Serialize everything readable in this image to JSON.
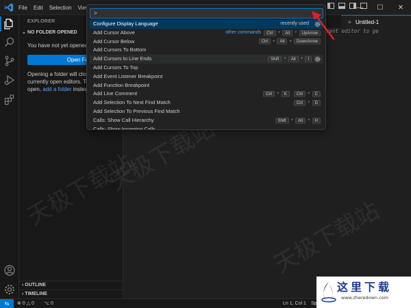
{
  "menubar": {
    "items": [
      "File",
      "Edit",
      "Selection",
      "View"
    ]
  },
  "window_controls": {
    "minimize": "—",
    "maximize": "☐",
    "close": "✕"
  },
  "sidebar": {
    "title": "EXPLORER",
    "section": "NO FOLDER OPENED",
    "line1": "You have not yet opened",
    "open_folder_label": "Open Folder",
    "line2": "Opening a folder will clos",
    "line3": "currently open editors. To",
    "line4_prefix": "open, ",
    "line4_link": "add a folder",
    "line4_suffix": " instea",
    "outline_label": "OUTLINE",
    "timeline_label": "TIMELINE"
  },
  "editor": {
    "tab_label": "Untitled-1",
    "hint_text": "rent editor to ge"
  },
  "palette": {
    "input_value": ">",
    "commands": [
      {
        "label": "Configure Display Language",
        "tag": "recently used",
        "tag_style": "normal",
        "keys": [],
        "gear": true,
        "state": "selected"
      },
      {
        "label": "Add Cursor Above",
        "tag": "other commands",
        "tag_style": "blue",
        "keys": [
          "Ctrl",
          "Alt",
          "UpArrow"
        ],
        "gear": false,
        "state": ""
      },
      {
        "label": "Add Cursor Below",
        "tag": "",
        "tag_style": "",
        "keys": [
          "Ctrl",
          "Alt",
          "DownArrow"
        ],
        "gear": false,
        "state": ""
      },
      {
        "label": "Add Cursors To Bottom",
        "tag": "",
        "tag_style": "",
        "keys": [],
        "gear": false,
        "state": ""
      },
      {
        "label": "Add Cursors to Line Ends",
        "tag": "",
        "tag_style": "",
        "keys": [
          "Shift",
          "Alt",
          "I"
        ],
        "gear": true,
        "state": "hover"
      },
      {
        "label": "Add Cursors To Top",
        "tag": "",
        "tag_style": "",
        "keys": [],
        "gear": false,
        "state": ""
      },
      {
        "label": "Add Event Listener Breakpoint",
        "tag": "",
        "tag_style": "",
        "keys": [],
        "gear": false,
        "state": ""
      },
      {
        "label": "Add Function Breakpoint",
        "tag": "",
        "tag_style": "",
        "keys": [],
        "gear": false,
        "state": ""
      },
      {
        "label": "Add Line Comment",
        "tag": "",
        "tag_style": "",
        "keys": [
          "Ctrl",
          "K",
          "|",
          "Ctrl",
          "C"
        ],
        "gear": false,
        "state": ""
      },
      {
        "label": "Add Selection To Next Find Match",
        "tag": "",
        "tag_style": "",
        "keys": [
          "Ctrl",
          "D"
        ],
        "gear": false,
        "state": ""
      },
      {
        "label": "Add Selection To Previous Find Match",
        "tag": "",
        "tag_style": "",
        "keys": [],
        "gear": false,
        "state": ""
      },
      {
        "label": "Calls: Show Call Hierarchy",
        "tag": "",
        "tag_style": "",
        "keys": [
          "Shift",
          "Alt",
          "H"
        ],
        "gear": false,
        "state": ""
      },
      {
        "label": "Calls: Show Incoming Calls",
        "tag": "",
        "tag_style": "",
        "keys": [],
        "gear": false,
        "state": ""
      }
    ]
  },
  "statusbar": {
    "errors": "0",
    "warnings": "0",
    "ports": "0",
    "position": "Ln 1, Col 1",
    "spaces": "Spa"
  },
  "watermark": {
    "text": "天极下载站"
  },
  "site_logo": {
    "name": "这里下载",
    "url": "www.zheredown.com"
  },
  "colors": {
    "accent": "#0078d4",
    "selection": "#04395e",
    "annotation": "#e02020"
  }
}
